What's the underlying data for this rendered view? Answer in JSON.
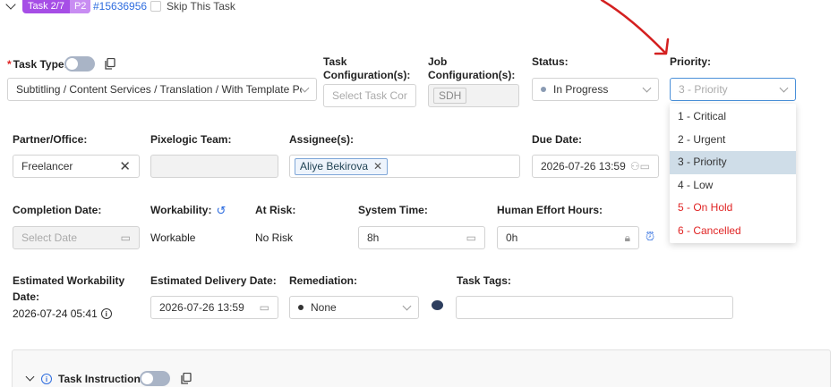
{
  "header": {
    "task_badge": "Task 2/7",
    "priority_badge": "P2",
    "task_id": "#15636956",
    "skip_label": "Skip This Task"
  },
  "fields": {
    "task_type": {
      "label": "Task Type:",
      "value": "Subtitling / Content Services / Translation / With Template Pos..."
    },
    "task_config": {
      "label": "Task Configuration(s):",
      "placeholder": "Select Task Con..."
    },
    "job_config": {
      "label": "Job Configuration(s):",
      "value": "SDH"
    },
    "status": {
      "label": "Status:",
      "value": "In Progress"
    },
    "priority": {
      "label": "Priority:",
      "value": "3 - Priority",
      "options": [
        "1 - Critical",
        "2 - Urgent",
        "3 - Priority",
        "4 - Low",
        "5 - On Hold",
        "6 - Cancelled"
      ]
    },
    "partner": {
      "label": "Partner/Office:",
      "value": "Freelancer"
    },
    "pixelogic_team": {
      "label": "Pixelogic Team:"
    },
    "assignee": {
      "label": "Assignee(s):",
      "value": "Aliye Bekirova"
    },
    "due_date": {
      "label": "Due Date:",
      "value": "2026-07-26 13:59"
    },
    "completion_date": {
      "label": "Completion Date:",
      "placeholder": "Select Date"
    },
    "workability": {
      "label": "Workability:",
      "value": "Workable"
    },
    "at_risk": {
      "label": "At Risk:",
      "value": "No Risk"
    },
    "system_time": {
      "label": "System Time:",
      "value": "8h"
    },
    "human_effort": {
      "label": "Human Effort Hours:",
      "value": "0h"
    },
    "est_workability": {
      "label_line1": "Estimated Workability",
      "label_line2": "Date:",
      "value": "2026-07-24 05:41"
    },
    "est_delivery": {
      "label": "Estimated Delivery Date:",
      "value": "2026-07-26 13:59"
    },
    "remediation": {
      "label": "Remediation:",
      "value": "None"
    },
    "task_tags": {
      "label": "Task Tags:"
    }
  },
  "instructions": {
    "label": "Task Instructions"
  },
  "colors": {
    "badge_purple": "#a64ee6",
    "badge_light": "#c88df2",
    "link_blue": "#2d6cdf",
    "required_red": "#e02424",
    "annotation_red": "#d42020"
  }
}
